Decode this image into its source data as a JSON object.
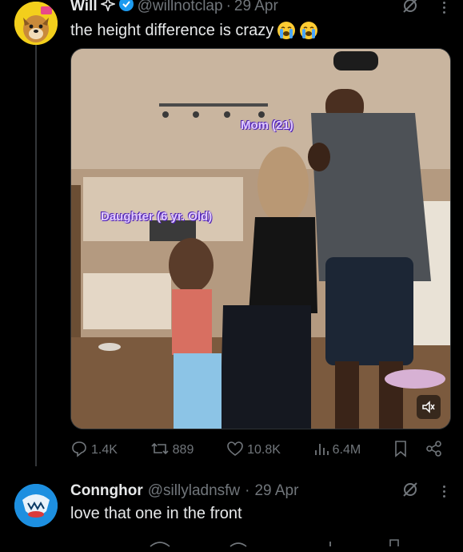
{
  "tweet": {
    "author_name": "Will",
    "handle": "@willnotclap",
    "separator": "·",
    "date": "29 Apr",
    "text": "the height difference is crazy",
    "media": {
      "label_mom": "Mom (21)",
      "label_daughter": "Daughter (6 yr. Old)"
    },
    "actions": {
      "replies": "1.4K",
      "retweets": "889",
      "likes": "10.8K",
      "views": "6.4M"
    }
  },
  "reply": {
    "author_name": "Connghor",
    "handle": "@sillyladnsfw",
    "separator": "·",
    "date": "29 Apr",
    "text": "love that one in the front"
  },
  "colors": {
    "background": "#000000",
    "text_primary": "#e7e9ea",
    "text_secondary": "#71767b",
    "verified": "#1d9bf0",
    "label_purple": "#e2ccff"
  },
  "icons": {
    "author_badges": [
      "sparkle-icon",
      "verified-badge-icon"
    ],
    "tweet_corner": [
      "grok-icon",
      "more-icon"
    ],
    "media": [
      "mute-icon"
    ],
    "actions": [
      "reply-icon",
      "retweet-icon",
      "like-icon",
      "views-icon",
      "bookmark-icon",
      "share-icon"
    ]
  }
}
